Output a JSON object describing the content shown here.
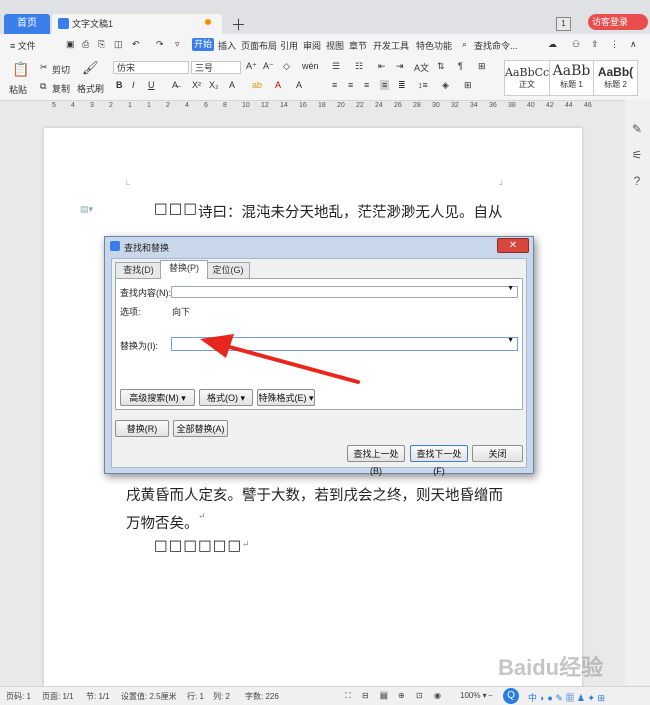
{
  "tabs": {
    "home": "首页",
    "doc": "文字文稿1",
    "badge": "1",
    "login": "访客登录"
  },
  "menu": {
    "file": "≡ 文件",
    "start": "开始",
    "items": [
      "插入",
      "页面布局",
      "引用",
      "审阅",
      "视图",
      "章节",
      "开发工具",
      "特色功能"
    ],
    "search": "查找命令..."
  },
  "ribbon": {
    "paste": "粘贴",
    "cut": "剪切",
    "copy": "复制",
    "format_painter": "格式刷",
    "font": "仿宋",
    "size": "三号",
    "styles": [
      {
        "sample": "AaBbCcI",
        "name": "正文"
      },
      {
        "sample": "AaBb",
        "name": "标题 1"
      },
      {
        "sample": "AaBb(",
        "name": "标题 2"
      }
    ]
  },
  "ruler": [
    "5",
    "4",
    "3",
    "2",
    "1",
    "1",
    "2",
    "4",
    "6",
    "8",
    "10",
    "12",
    "14",
    "16",
    "18",
    "20",
    "22",
    "24",
    "26",
    "28",
    "30",
    "32",
    "34",
    "36",
    "38",
    "40",
    "42",
    "44",
    "46"
  ],
  "document": {
    "line1": "诗曰：混沌未分天地乱，茫茫渺渺无人见。自从",
    "line1_boxes": "□□□",
    "line2": "戌黄昏而人定亥。譬于大数，若到戌会之终，则天地昏缯而",
    "line3": "万物否矣。",
    "line4_boxes": "□□□□□□",
    "para_mark": "↵"
  },
  "dialog": {
    "title": "查找和替换",
    "tabs": [
      "查找(D)",
      "替换(P)",
      "定位(G)"
    ],
    "find_label": "查找内容(N):",
    "options_label": "选项:",
    "options_value": "向下",
    "replace_label": "替换为(I):",
    "advanced": "高级搜索(M) ▾",
    "format": "格式(O) ▾",
    "special": "特殊格式(E) ▾",
    "replace_btn": "替换(R)",
    "replace_all": "全部替换(A)",
    "find_prev": "查找上一处(B)",
    "find_next": "查找下一处(F)",
    "close": "关闭"
  },
  "status": {
    "page": "页码: 1",
    "pages": "页面: 1/1",
    "section": "节: 1/1",
    "setting": "设置值: 2.5厘米",
    "row": "行: 1",
    "col": "列: 2",
    "words": "字数: 226",
    "zoom": "100% ▾"
  },
  "watermark": "Baidu经验"
}
